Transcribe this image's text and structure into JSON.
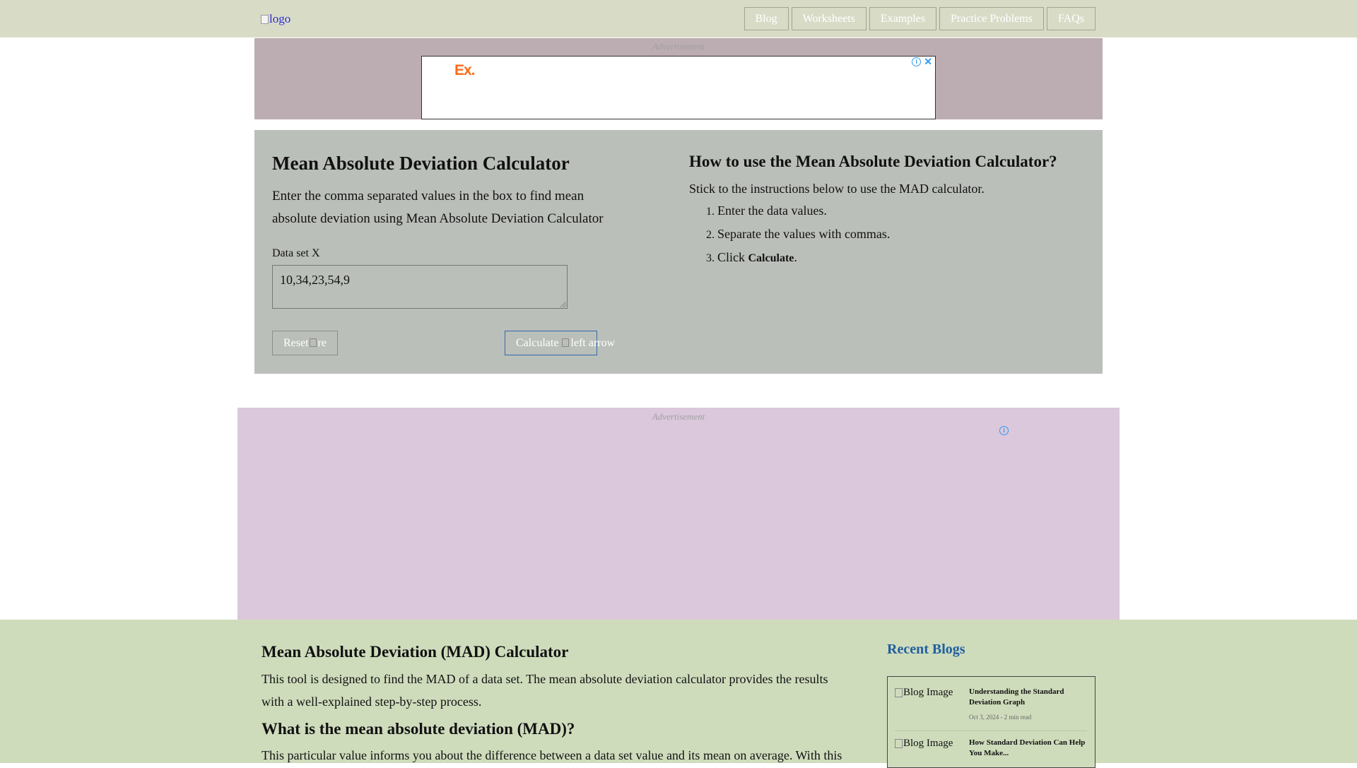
{
  "header": {
    "logo_alt": "logo",
    "nav": [
      "Blog",
      "Worksheets",
      "Examples",
      "Practice Problems",
      "FAQs"
    ]
  },
  "ads": {
    "label": "Advertisement",
    "brand": "Ex."
  },
  "calculator": {
    "title": "Mean Absolute Deviation Calculator",
    "description": "Enter the comma separated values in the box to find mean absolute deviation using Mean Absolute Deviation Calculator",
    "dataset_label": "Data set X",
    "dataset_value": "10,34,23,54,9",
    "reset_label": "Reset",
    "reset_img_alt": "re",
    "calculate_label": "Calculate",
    "calculate_img_alt": "left arrow"
  },
  "howto": {
    "title": "How to use the Mean Absolute Deviation Calculator?",
    "intro": "Stick to the instructions below to use the MAD calculator.",
    "steps": [
      "Enter the data values.",
      "Separate the values with commas."
    ],
    "step3_prefix": "Click ",
    "step3_bold": "Calculate",
    "step3_suffix": "."
  },
  "content": {
    "heading1": "Mean Absolute Deviation (MAD) Calculator",
    "para1": "This tool is designed to find the MAD of a data set. The mean absolute deviation calculator provides the results with a well-explained step-by-step process.",
    "heading2": "What is the mean absolute deviation (MAD)?",
    "para2": "This particular value informs you about the difference between a data set value and its mean on average. With this"
  },
  "recent_blogs": {
    "title": "Recent Blogs",
    "image_alt": "Blog Image",
    "items": [
      {
        "title": "Understanding the Standard Deviation Graph",
        "meta": "Oct 3, 2024 - 2 min read"
      },
      {
        "title": "How Standard Deviation Can Help You Make...",
        "meta": ""
      }
    ]
  },
  "colors": {
    "header_bg": "#d8dcc7",
    "ad1_bg": "#bcadb2",
    "calc_bg": "#bbbfb9",
    "ad2_bg": "#dbc8dc",
    "content_bg": "#cfdcbc",
    "accent_link": "#1f5fa0",
    "ad_brand": "#ff6a13"
  }
}
